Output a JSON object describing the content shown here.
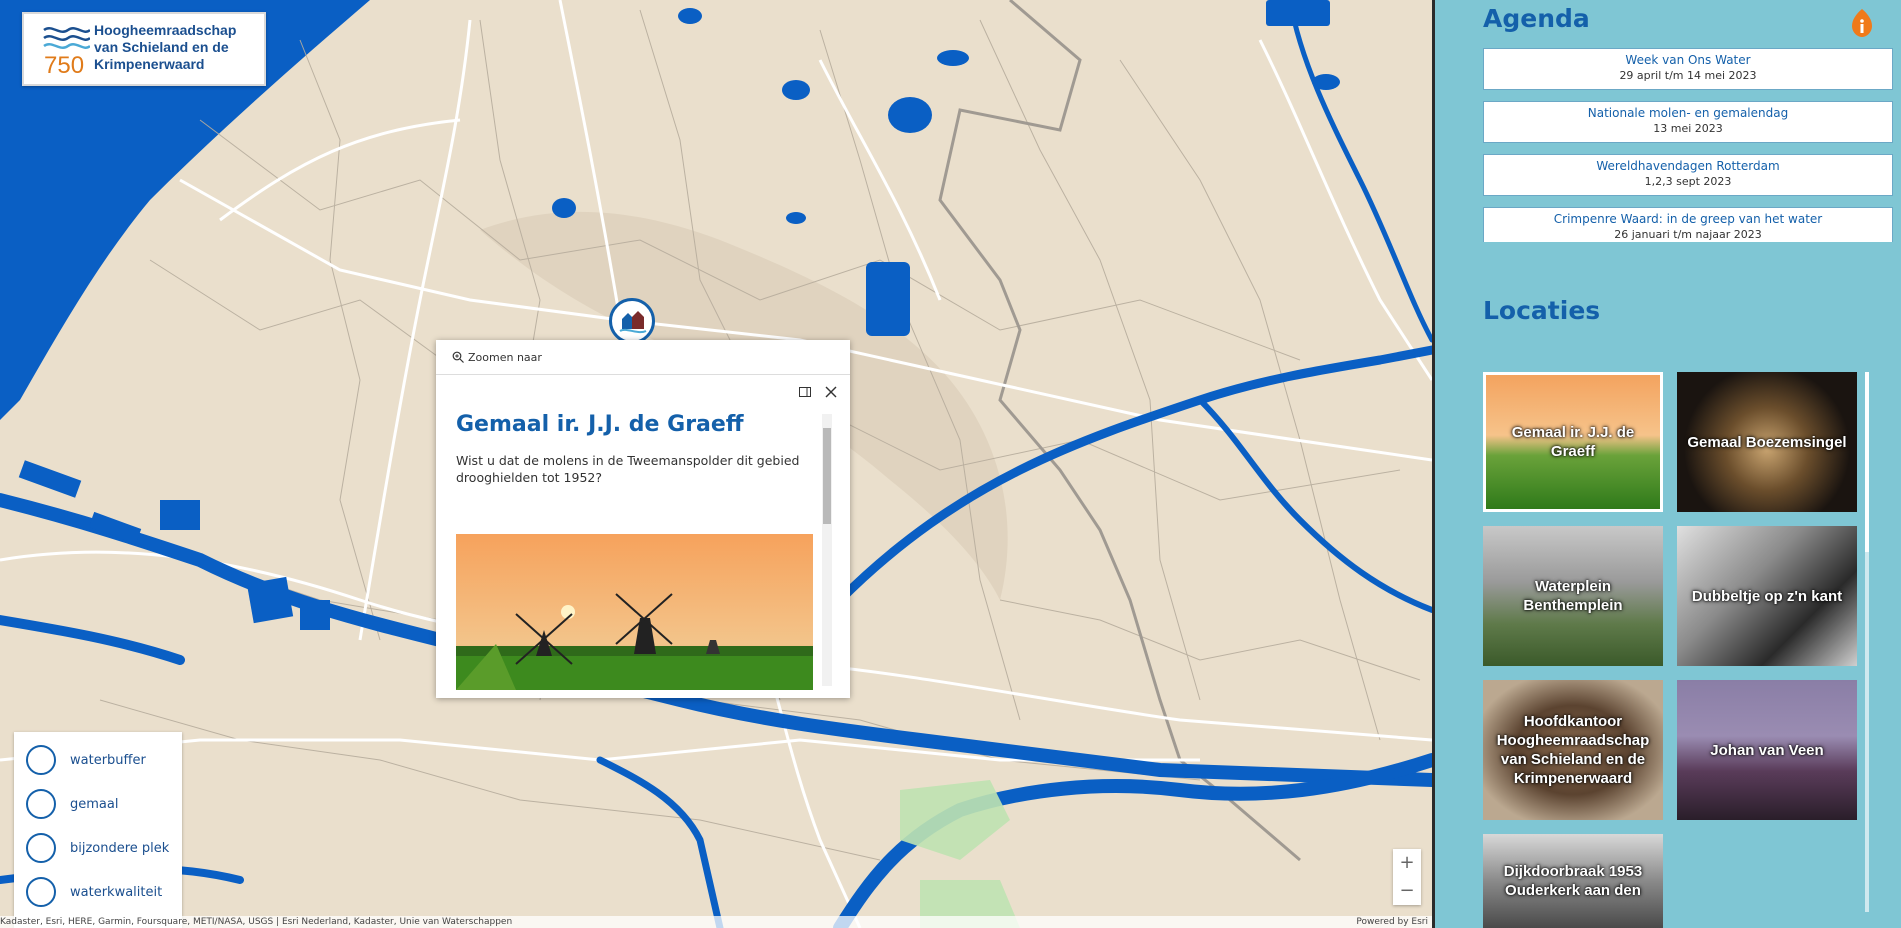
{
  "logo": {
    "years": "750",
    "lines": [
      "Hoogheemraadschap",
      "van Schieland en de",
      "Krimpenerwaard"
    ]
  },
  "popup": {
    "zoom_label": "Zoomen naar",
    "title": "Gemaal ir. J.J. de Graeff",
    "body": "Wist u dat de molens in de Tweemanspolder dit gebied drooghielden tot 1952?"
  },
  "legend": {
    "items": [
      {
        "label": "waterbuffer",
        "icon": "waterbuffer-icon"
      },
      {
        "label": "gemaal",
        "icon": "gemaal-icon"
      },
      {
        "label": "bijzondere plek",
        "icon": "bijzondere-plek-icon"
      },
      {
        "label": "waterkwaliteit",
        "icon": "waterkwaliteit-icon"
      }
    ]
  },
  "zoom": {
    "in": "+",
    "out": "−"
  },
  "attribution": {
    "left": "Kadaster, Esri, HERE, Garmin, Foursquare, METI/NASA, USGS | Esri Nederland, Kadaster, Unie van Waterschappen",
    "right": "Powered by Esri"
  },
  "panel": {
    "agenda_title": "Agenda",
    "agenda": [
      {
        "title": "Week van Ons Water",
        "date": "29 april t/m 14 mei 2023"
      },
      {
        "title": "Nationale molen- en gemalendag",
        "date": "13 mei 2023"
      },
      {
        "title": "Wereldhavendagen Rotterdam",
        "date": "1,2,3 sept 2023"
      },
      {
        "title": "Crimpenre Waard: in de greep van het water",
        "date": "26 januari t/m najaar 2023"
      }
    ],
    "locations_title": "Locaties",
    "locations": [
      {
        "label": "Gemaal ir. J.J. de Graeff"
      },
      {
        "label": "Gemaal Boezemsingel"
      },
      {
        "label": "Waterplein Benthemplein"
      },
      {
        "label": "Dubbeltje op z'n kant"
      },
      {
        "label": "Hoofdkantoor Hoogheemraadschap van Schieland en de Krimpenerwaard"
      },
      {
        "label": "Johan van Veen"
      },
      {
        "label": "Dijkdoorbraak 1953 Ouderkerk aan den"
      }
    ]
  },
  "colors": {
    "water": "#0a5fc4",
    "land": "#eadfcc",
    "panel": "#7fc6d4",
    "accent": "#1460aa"
  }
}
